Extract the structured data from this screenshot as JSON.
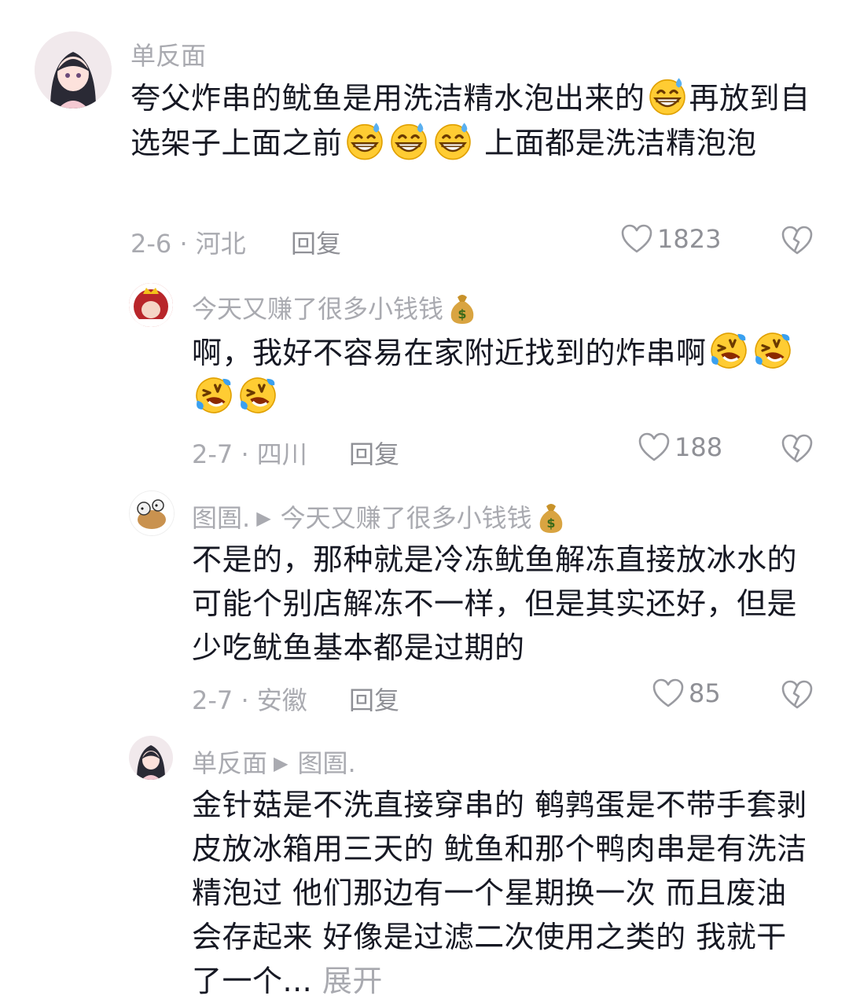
{
  "comments": [
    {
      "username": "单反面",
      "text_parts": [
        "夸父炸串的鱿鱼是用洗洁精水泡出来的",
        "再放到自选架子上面之前",
        " 上面都是洗洁精泡泡"
      ],
      "date_loc": "2-6 · 河北",
      "reply": "回复",
      "likes": "1823"
    },
    {
      "username": "今天又赚了很多小钱钱",
      "text_parts": [
        "啊，我好不容易在家附近找到的炸串啊"
      ],
      "date_loc": "2-7 · 四川",
      "reply": "回复",
      "likes": "188"
    },
    {
      "username": "图圄.",
      "reply_to": "今天又赚了很多小钱钱",
      "text": "不是的，那种就是冷冻鱿鱼解冻直接放冰水的可能个别店解冻不一样，但是其实还好，但是少吃鱿鱼基本都是过期的",
      "date_loc": "2-7 · 安徽",
      "reply": "回复",
      "likes": "85"
    },
    {
      "username": "单反面",
      "reply_to": "图圄.",
      "text": "金针菇是不洗直接穿串的 鹌鹑蛋是不带手套剥皮放冰箱用三天的 鱿鱼和那个鸭肉串是有洗洁精泡过 他们那边有一个星期换一次 而且废油会存起来 好像是过滤二次使用之类的 我就干了一个...",
      "expand": "展开"
    }
  ],
  "icons": {
    "like": "heart-outline-icon",
    "dislike": "broken-heart-icon",
    "emoji_sweat": "grinning-sweat-emoji",
    "emoji_laugh": "rolling-laughing-emoji",
    "money_bag": "money-bag-emoji"
  },
  "colors": {
    "text": "#161823",
    "muted": "#a9aab0",
    "background": "#ffffff"
  }
}
